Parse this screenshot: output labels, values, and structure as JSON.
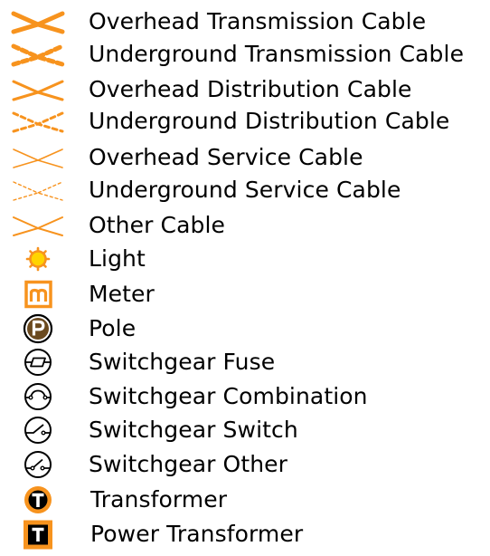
{
  "legend": {
    "items": [
      {
        "label": "Overhead Transmission Cable",
        "symbol": "overhead-transmission-cable-icon"
      },
      {
        "label": "Underground Transmission Cable",
        "symbol": "underground-transmission-cable-icon"
      },
      {
        "label": "Overhead Distribution Cable",
        "symbol": "overhead-distribution-cable-icon"
      },
      {
        "label": "Underground Distribution Cable",
        "symbol": "underground-distribution-cable-icon"
      },
      {
        "label": "Overhead Service Cable",
        "symbol": "overhead-service-cable-icon"
      },
      {
        "label": "Underground Service Cable",
        "symbol": "underground-service-cable-icon"
      },
      {
        "label": "Other Cable",
        "symbol": "other-cable-icon"
      },
      {
        "label": "Light",
        "symbol": "light-icon"
      },
      {
        "label": "Meter",
        "symbol": "meter-icon"
      },
      {
        "label": "Pole",
        "symbol": "pole-icon"
      },
      {
        "label": "Switchgear Fuse",
        "symbol": "switchgear-fuse-icon"
      },
      {
        "label": "Switchgear Combination",
        "symbol": "switchgear-combination-icon"
      },
      {
        "label": "Switchgear Switch",
        "symbol": "switchgear-switch-icon"
      },
      {
        "label": "Switchgear Other",
        "symbol": "switchgear-other-icon"
      },
      {
        "label": "Transformer",
        "symbol": "transformer-icon"
      },
      {
        "label": "Power Transformer",
        "symbol": "power-transformer-icon"
      }
    ]
  },
  "colors": {
    "accent": "#f7931e",
    "light_fill": "#ffd400",
    "pole_fill": "#6b4a1f",
    "text": "#000000"
  }
}
